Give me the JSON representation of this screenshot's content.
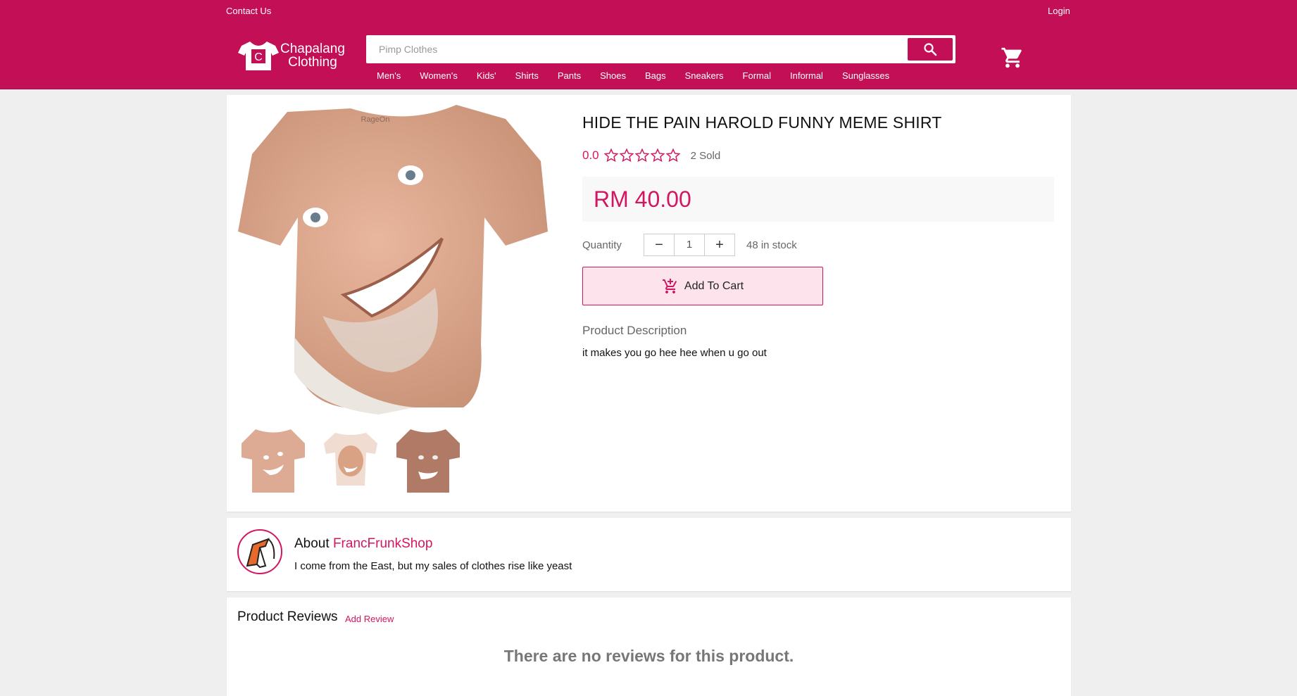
{
  "header": {
    "contact_label": "Contact Us",
    "login_label": "Login",
    "logo_letter": "C",
    "logo_line1": "Chapalang",
    "logo_line2": "Clothing",
    "search_placeholder": "Pimp Clothes",
    "nav": [
      "Men's",
      "Women's",
      "Kids'",
      "Shirts",
      "Pants",
      "Shoes",
      "Bags",
      "Sneakers",
      "Formal",
      "Informal",
      "Sunglasses"
    ]
  },
  "product": {
    "title": "HIDE THE PAIN HAROLD FUNNY MEME SHIRT",
    "rating": "0.0",
    "stars_filled": 0,
    "stars_total": 5,
    "sold": "2 Sold",
    "price": "RM 40.00",
    "quantity_label": "Quantity",
    "quantity_value": "1",
    "decrement": "−",
    "increment": "+",
    "stock": "48 in stock",
    "add_to_cart": "Add To Cart",
    "description_label": "Product Description",
    "description": "it makes you go hee hee when u go out",
    "image_tag": "RageOn"
  },
  "shop": {
    "about_prefix": "About",
    "name": "FrancFrunkShop",
    "tagline": "I come from the East, but my sales of clothes rise like yeast"
  },
  "reviews": {
    "title": "Product Reviews",
    "add_label": "Add Review",
    "empty_text": "There are no reviews for this product."
  },
  "colors": {
    "brand": "#c30f55",
    "accent": "#d31660",
    "price_bg": "#f8f8f8",
    "add_cart_bg": "#fde3ec"
  }
}
